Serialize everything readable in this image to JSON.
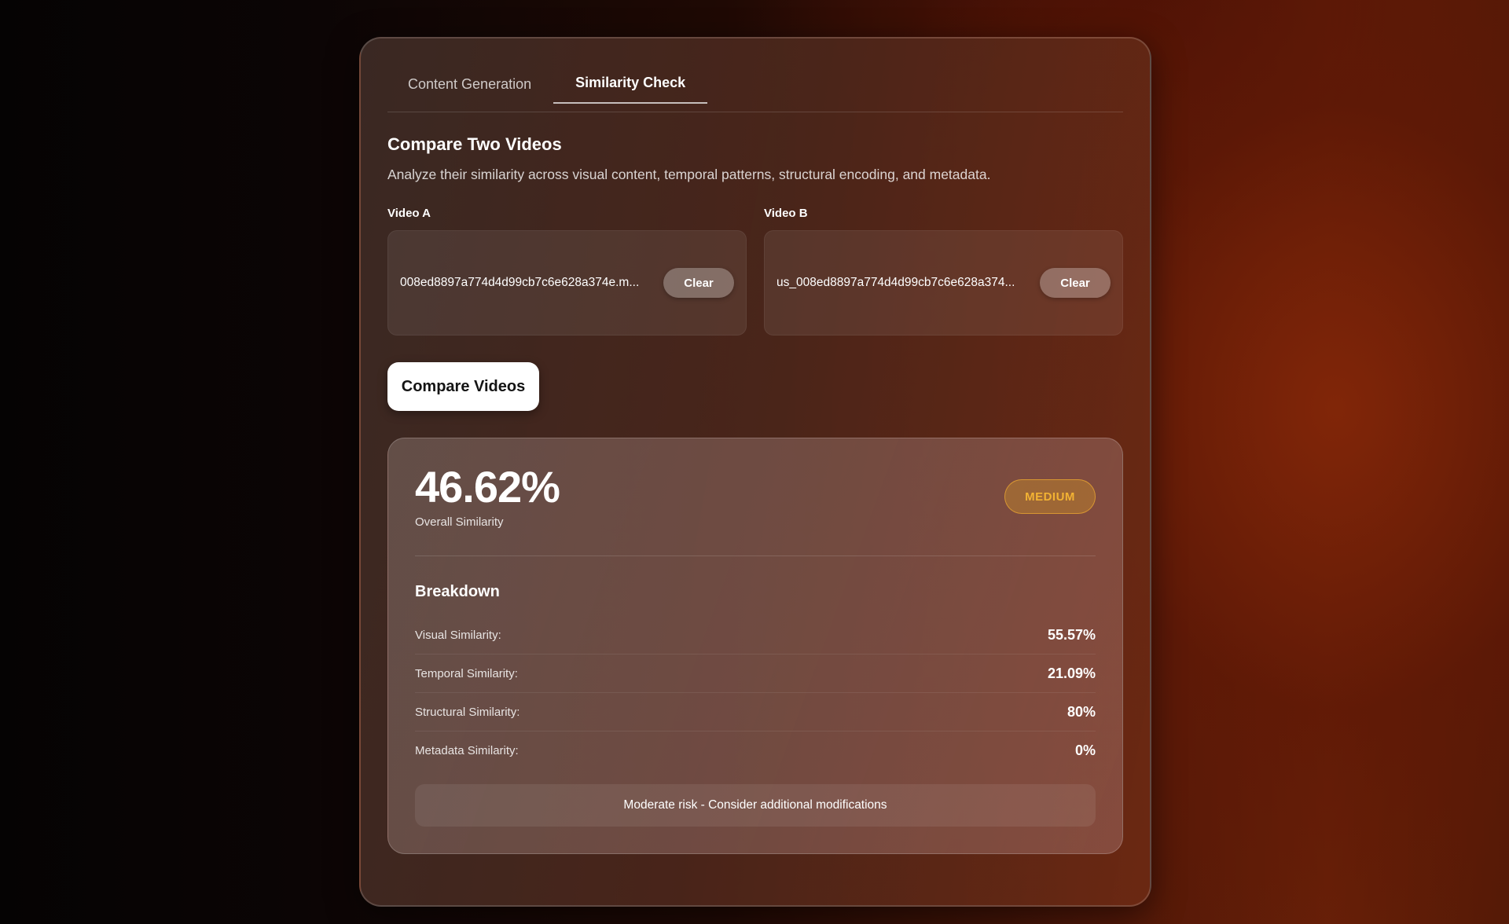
{
  "tabs": [
    {
      "label": "Content Generation",
      "active": false
    },
    {
      "label": "Similarity Check",
      "active": true
    }
  ],
  "section": {
    "title": "Compare Two Videos",
    "description": "Analyze their similarity across visual content, temporal patterns, structural encoding, and metadata."
  },
  "video_a": {
    "label": "Video A",
    "filename": "008ed8897a774d4d99cb7c6e628a374e.m...",
    "clear_label": "Clear"
  },
  "video_b": {
    "label": "Video B",
    "filename": "us_008ed8897a774d4d99cb7c6e628a374...",
    "clear_label": "Clear"
  },
  "compare_button": "Compare Videos",
  "result": {
    "overall_value": "46.62%",
    "overall_label": "Overall Similarity",
    "risk_badge": "MEDIUM",
    "breakdown_title": "Breakdown",
    "breakdown": [
      {
        "label": "Visual Similarity:",
        "value": "55.57%"
      },
      {
        "label": "Temporal Similarity:",
        "value": "21.09%"
      },
      {
        "label": "Structural Similarity:",
        "value": "80%"
      },
      {
        "label": "Metadata Similarity:",
        "value": "0%"
      }
    ],
    "risk_message": "Moderate risk - Consider additional modifications"
  },
  "colors": {
    "badge_text": "#f2b233",
    "accent_background": "#6a2208"
  }
}
